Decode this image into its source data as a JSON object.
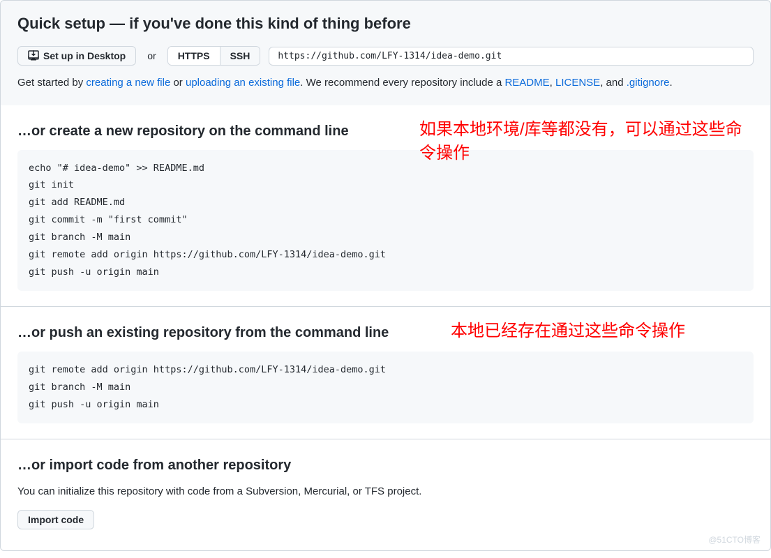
{
  "quickSetup": {
    "title": "Quick setup — if you've done this kind of thing before",
    "desktopButton": "Set up in Desktop",
    "orText": "or",
    "httpsLabel": "HTTPS",
    "sshLabel": "SSH",
    "cloneUrl": "https://github.com/LFY-1314/idea-demo.git",
    "helpText": {
      "prefix": "Get started by ",
      "link1": "creating a new file",
      "middle1": " or ",
      "link2": "uploading an existing file",
      "middle2": ". We recommend every repository include a ",
      "link3": "README",
      "sep1": ", ",
      "link4": "LICENSE",
      "sep2": ", and ",
      "link5": ".gitignore",
      "suffix": "."
    }
  },
  "createRepo": {
    "title": "…or create a new repository on the command line",
    "code": "echo \"# idea-demo\" >> README.md\ngit init\ngit add README.md\ngit commit -m \"first commit\"\ngit branch -M main\ngit remote add origin https://github.com/LFY-1314/idea-demo.git\ngit push -u origin main",
    "annotation": "如果本地环境/库等都没有，可以通过这些命令操作"
  },
  "pushRepo": {
    "title": "…or push an existing repository from the command line",
    "code": "git remote add origin https://github.com/LFY-1314/idea-demo.git\ngit branch -M main\ngit push -u origin main",
    "annotation": "本地已经存在通过这些命令操作"
  },
  "importRepo": {
    "title": "…or import code from another repository",
    "description": "You can initialize this repository with code from a Subversion, Mercurial, or TFS project.",
    "buttonLabel": "Import code"
  },
  "watermark": "@51CTO博客"
}
